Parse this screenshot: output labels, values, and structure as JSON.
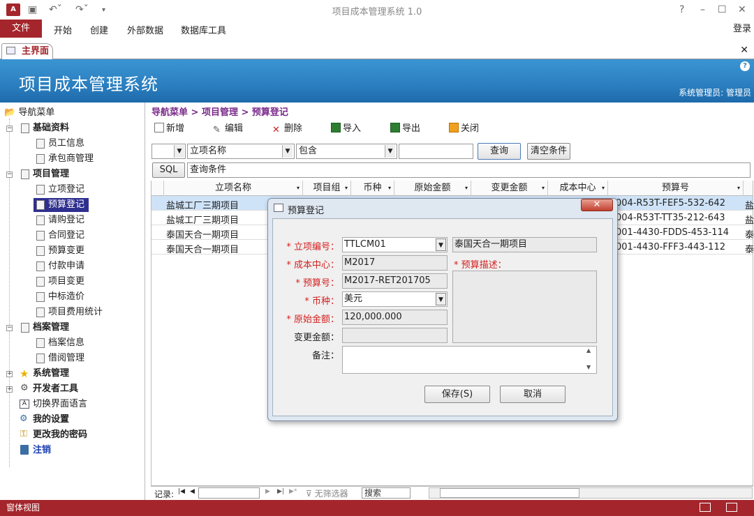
{
  "window": {
    "title": "项目成本管理系统 1.0",
    "help": "?",
    "minimize": "–",
    "maximize": "☐",
    "close": "✕"
  },
  "ribbon": {
    "file": "文件",
    "tabs": [
      "开始",
      "创建",
      "外部数据",
      "数据库工具"
    ],
    "login": "登录"
  },
  "doc_tab": {
    "label": "主界面",
    "close": "✕"
  },
  "banner": {
    "title": "项目成本管理系统",
    "user": "系统管理员: 管理员"
  },
  "nav": {
    "root": "导航菜单",
    "g1": "基础资料",
    "g1_items": [
      "员工信息",
      "承包商管理"
    ],
    "g2": "项目管理",
    "g2_items": [
      "立项登记",
      "预算登记",
      "请购登记",
      "合同登记",
      "预算变更",
      "付款申请",
      "项目变更",
      "中标造价",
      "项目费用统计"
    ],
    "g3": "档案管理",
    "g3_items": [
      "档案信息",
      "借阅管理"
    ],
    "g4": "系统管理",
    "g5": "开发者工具",
    "lang": "切换界面语言",
    "settings": "我的设置",
    "pwd": "更改我的密码",
    "logout": "注销"
  },
  "breadcrumb": "导航菜单 > 项目管理 > 预算登记",
  "toolbar": {
    "new": "新增",
    "edit": "编辑",
    "delete": "删除",
    "import": "导入",
    "export": "导出",
    "close": "关闭"
  },
  "filter": {
    "field": "立项名称",
    "op": "包含",
    "value": "",
    "query": "查询",
    "clear": "清空条件",
    "sql": "SQL",
    "sql_text": "查询条件"
  },
  "grid": {
    "headers": [
      "立项名称",
      "项目组",
      "币种",
      "原始金额",
      "变更金额",
      "成本中心",
      "预算号"
    ],
    "rows": [
      {
        "name": "盐城工厂三期项目",
        "budget": "004-R53T-FEF5-532-642",
        "extra": "盐"
      },
      {
        "name": "盐城工厂三期项目",
        "budget": "004-R53T-TT35-212-643",
        "extra": "盐"
      },
      {
        "name": "泰国天合一期项目",
        "budget": "001-4430-FDDS-453-114",
        "extra": "泰"
      },
      {
        "name": "泰国天合一期项目",
        "budget": "001-4430-FFF3-443-112",
        "extra": "泰"
      }
    ]
  },
  "record_bar": {
    "label": "记录:",
    "first": "⏮",
    "prev": "◀",
    "next": "▶",
    "last": "⏭",
    "new": "▶*",
    "no_filter": "无筛选器",
    "search": "搜索"
  },
  "status": {
    "text": "窗体视图"
  },
  "dialog": {
    "title": "预算登记",
    "close": "✕",
    "project_no_label": "* 立项编号：",
    "project_no": "TTLCM01",
    "project_name": "泰国天合一期项目",
    "cost_center_label": "* 成本中心：",
    "cost_center": "M2017",
    "budget_desc_label": "* 预算描述：",
    "budget_no_label": "* 预算号：",
    "budget_no": "M2017-RET201705",
    "currency_label": "* 币种：",
    "currency": "美元",
    "orig_amount_label": "* 原始金额：",
    "orig_amount": "120,000.000",
    "change_amount_label": "变更金额：",
    "change_amount": "",
    "remark_label": "备注：",
    "remark": "",
    "save": "保存(S)",
    "cancel": "取消"
  }
}
